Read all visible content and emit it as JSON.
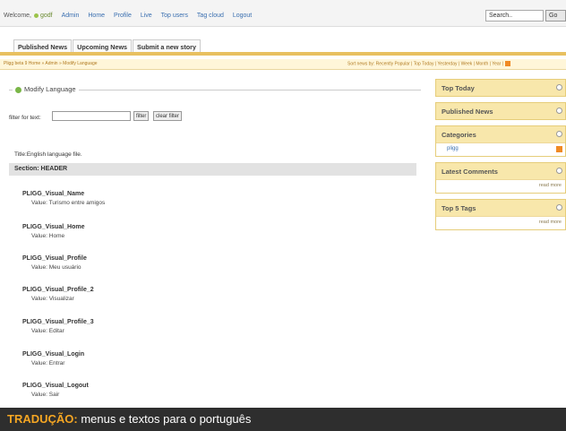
{
  "topnav": {
    "welcome": "Welcome,",
    "user": "godf",
    "links": [
      "Admin",
      "Home",
      "Profile",
      "Live",
      "Top users",
      "Tag cloud",
      "Logout"
    ],
    "search_placeholder": "Search..",
    "go_label": "Go"
  },
  "tabs": [
    "Published News",
    "Upcoming News",
    "Submit a new story"
  ],
  "breadcrumb": {
    "path": "Pligg beta 9 Home » Admin » Modify Language",
    "sort_label": "Sort news by: Recently Popular | Top Today | Yesterday | Week | Month | Year |"
  },
  "main": {
    "legend": "Modify Language",
    "filter_label": "filter for text:",
    "filter_value": "",
    "filter_button": "filter",
    "clear_button": "clear filter",
    "title": "Title:English language file.",
    "section": "Section: HEADER",
    "entries": [
      {
        "key": "PLIGG_Visual_Name",
        "value": "Value: Turismo entre amigos"
      },
      {
        "key": "PLIGG_Visual_Home",
        "value": "Value: Home"
      },
      {
        "key": "PLIGG_Visual_Profile",
        "value": "Value: Meu usuário"
      },
      {
        "key": "PLIGG_Visual_Profile_2",
        "value": "Value: Visualizar"
      },
      {
        "key": "PLIGG_Visual_Profile_3",
        "value": "Value: Editar"
      },
      {
        "key": "PLIGG_Visual_Login",
        "value": "Value: Entrar"
      },
      {
        "key": "PLIGG_Visual_Logout",
        "value": "Value: Sair"
      }
    ]
  },
  "sidebar": {
    "top_today": "Top Today",
    "published": "Published News",
    "categories": "Categories",
    "category_item": "pligg",
    "latest_comments": "Latest Comments",
    "top_tags": "Top 5 Tags",
    "read_more": "read more"
  },
  "caption": {
    "bold": "TRADUÇÃO:",
    "text": " menus e textos para o português"
  },
  "colors": {
    "accent": "#f8e7ab",
    "caption_bg": "#2e2e2e",
    "caption_highlight": "#f5a623"
  }
}
